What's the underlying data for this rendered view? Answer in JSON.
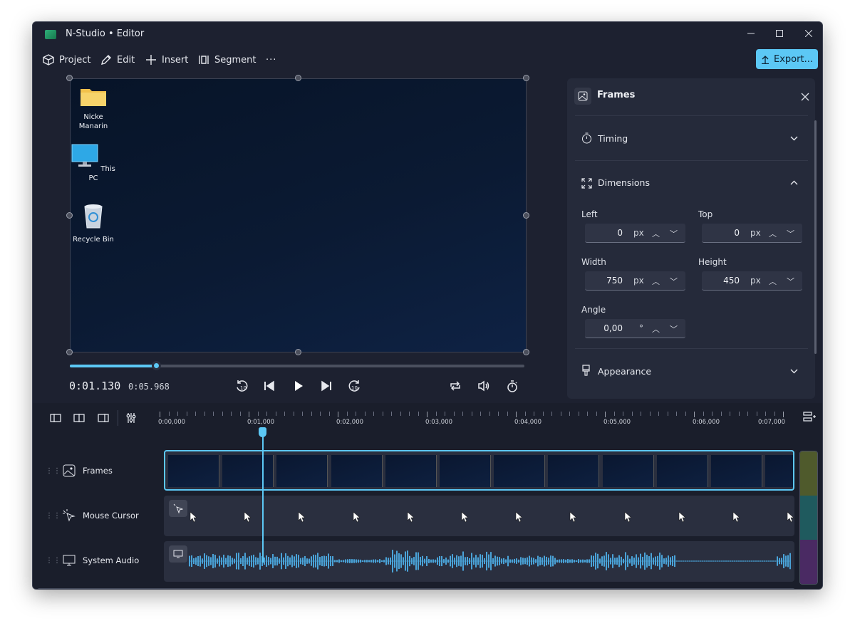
{
  "window": {
    "title": "N-Studio • Editor"
  },
  "toolbar": {
    "project": "Project",
    "edit": "Edit",
    "insert": "Insert",
    "segment": "Segment",
    "more": "···",
    "export": "Export..."
  },
  "desktop_icons": [
    {
      "label": "Nicke Manarin",
      "icon": "folder-icon"
    },
    {
      "label": "This PC",
      "icon": "monitor-icon"
    },
    {
      "label": "Recycle Bin",
      "icon": "recycle-bin-icon"
    }
  ],
  "playback": {
    "current": "0:01.130",
    "total": "0:05.968",
    "progress": 0.19
  },
  "panel": {
    "title": "Frames",
    "sections": {
      "timing": "Timing",
      "dimensions": "Dimensions",
      "appearance": "Appearance"
    },
    "fields": {
      "left": {
        "label": "Left",
        "value": "0",
        "unit": "px"
      },
      "top": {
        "label": "Top",
        "value": "0",
        "unit": "px"
      },
      "width": {
        "label": "Width",
        "value": "750",
        "unit": "px"
      },
      "height": {
        "label": "Height",
        "value": "450",
        "unit": "px"
      },
      "angle": {
        "label": "Angle",
        "value": "0,00",
        "unit": "°"
      }
    }
  },
  "timeline": {
    "ruler_labels": [
      "0:00,000",
      "0:01,000",
      "0:02,000",
      "0:03,000",
      "0:04,000",
      "0:05,000",
      "0:06,000",
      "0:07,000"
    ],
    "tracks": [
      {
        "label": "Frames"
      },
      {
        "label": "Mouse Cursor"
      },
      {
        "label": "System Audio"
      }
    ],
    "track_colors": [
      "#4f5a2c",
      "#1f5a5e",
      "#4a2a63"
    ]
  },
  "colors": {
    "accent": "#5cc8f5",
    "window_bg": "#1d2130",
    "panel_bg": "#252a3a"
  }
}
